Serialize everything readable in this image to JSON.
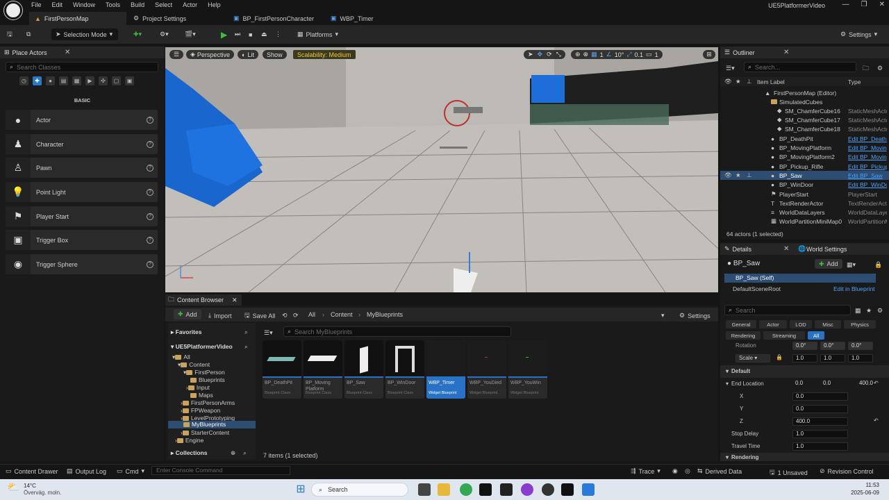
{
  "menubar": {
    "items": [
      "File",
      "Edit",
      "Window",
      "Tools",
      "Build",
      "Select",
      "Actor",
      "Help"
    ],
    "project_name": "UE5PlatformerVideo"
  },
  "tabs": [
    {
      "label": "FirstPersonMap",
      "active": true
    },
    {
      "label": "Project Settings",
      "active": false
    },
    {
      "label": "BP_FirstPersonCharacter",
      "active": false
    },
    {
      "label": "WBP_Timer",
      "active": false
    }
  ],
  "toolbar": {
    "selection_mode": "Selection Mode",
    "platforms": "Platforms",
    "settings": "Settings"
  },
  "place_actors": {
    "title": "Place Actors",
    "search_placeholder": "Search Classes",
    "category": "BASIC",
    "items": [
      "Actor",
      "Character",
      "Pawn",
      "Point Light",
      "Player Start",
      "Trigger Box",
      "Trigger Sphere"
    ]
  },
  "viewport": {
    "perspective": "Perspective",
    "lit": "Lit",
    "show": "Show",
    "scalability": "Scalability: Medium",
    "grid_value": "1",
    "angle_value": "10°",
    "scale_value": "0.1",
    "camera_speed": "1"
  },
  "content_browser": {
    "title": "Content Browser",
    "add": "Add",
    "import": "Import",
    "save_all": "Save All",
    "settings": "Settings",
    "breadcrumb": [
      "All",
      "Content",
      "MyBlueprints"
    ],
    "favorites": "Favorites",
    "project": "UE5PlatformerVideo",
    "search_placeholder": "Search MyBlueprints",
    "collections": "Collections",
    "status": "7 items (1 selected)",
    "tree": [
      "All",
      "Content",
      "FirstPerson",
      "Blueprints",
      "Input",
      "Maps",
      "FirstPersonArms",
      "FPWeapon",
      "LevelPrototyping",
      "MyBlueprints",
      "StarterContent",
      "Engine"
    ],
    "assets": [
      {
        "name": "BP_DeathPit",
        "class": "Blueprint Class"
      },
      {
        "name": "BP_Moving Platform",
        "class": "Blueprint Class"
      },
      {
        "name": "BP_Saw",
        "class": "Blueprint Class"
      },
      {
        "name": "BP_WinDoor",
        "class": "Blueprint Class"
      },
      {
        "name": "WBP_Timer",
        "class": "Widget Blueprint"
      },
      {
        "name": "WBP_YouDied",
        "class": "Widget Blueprint"
      },
      {
        "name": "WBP_YouWin",
        "class": "Widget Blueprint"
      }
    ]
  },
  "outliner": {
    "title": "Outliner",
    "search_placeholder": "Search...",
    "col_label": "Item Label",
    "col_type": "Type",
    "rows": [
      {
        "label": "FirstPersonMap (Editor)",
        "type": ""
      },
      {
        "label": "SimulatedCubes",
        "type": ""
      },
      {
        "label": "SM_ChamferCube16",
        "type": "StaticMeshActor"
      },
      {
        "label": "SM_ChamferCube17",
        "type": "StaticMeshActor"
      },
      {
        "label": "SM_ChamferCube18",
        "type": "StaticMeshActor"
      },
      {
        "label": "BP_DeathPit",
        "type": "Edit BP_DeathPit"
      },
      {
        "label": "BP_MovingPlatform",
        "type": "Edit BP_MovingPlatform"
      },
      {
        "label": "BP_MovingPlatform2",
        "type": "Edit BP_MovingPlatform"
      },
      {
        "label": "BP_Pickup_Rifle",
        "type": "Edit BP_Pickup_Rifle"
      },
      {
        "label": "BP_Saw",
        "type": "Edit BP_Saw"
      },
      {
        "label": "BP_WinDoor",
        "type": "Edit BP_WinDoor"
      },
      {
        "label": "PlayerStart",
        "type": "PlayerStart"
      },
      {
        "label": "TextRenderActor",
        "type": "TextRenderActor"
      },
      {
        "label": "WorldDataLayers",
        "type": "WorldDataLayers"
      },
      {
        "label": "WorldPartitionMiniMap0",
        "type": "WorldPartitionMiniMap"
      }
    ],
    "status": "64 actors (1 selected)"
  },
  "details": {
    "title": "Details",
    "world_settings": "World Settings",
    "actor_name": "BP_Saw",
    "add": "Add",
    "self_label": "BP_Saw (Self)",
    "root": "DefaultSceneRoot",
    "edit_in_blueprint": "Edit in Blueprint",
    "search_placeholder": "Search",
    "categories": [
      "General",
      "Actor",
      "LOD",
      "Misc",
      "Physics",
      "Rendering",
      "Streaming",
      "All"
    ],
    "rotation_label": "Rotation",
    "rotation": [
      "0.0°",
      "0.0°",
      "0.0°"
    ],
    "scale_label": "Scale",
    "scale": [
      "1.0",
      "1.0",
      "1.0"
    ],
    "default_section": "Default",
    "end_location_label": "End Location",
    "end_location": [
      "0.0",
      "0.0",
      "400.0"
    ],
    "x_label": "X",
    "x": "0.0",
    "y_label": "Y",
    "y": "0.0",
    "z_label": "Z",
    "z": "400.0",
    "stop_delay_label": "Stop Delay",
    "stop_delay": "1.0",
    "travel_time_label": "Travel Time",
    "travel_time": "1.0",
    "rendering_section": "Rendering"
  },
  "statusbar": {
    "content_drawer": "Content Drawer",
    "output_log": "Output Log",
    "cmd": "Cmd",
    "console_placeholder": "Enter Console Command",
    "trace": "Trace",
    "derived_data": "Derived Data",
    "unsaved": "1 Unsaved",
    "revision_control": "Revision Control"
  },
  "taskbar": {
    "temp": "14°C",
    "weather": "Överväg. moln.",
    "search": "Search",
    "time": "11:53",
    "date": "2025-06-09"
  }
}
